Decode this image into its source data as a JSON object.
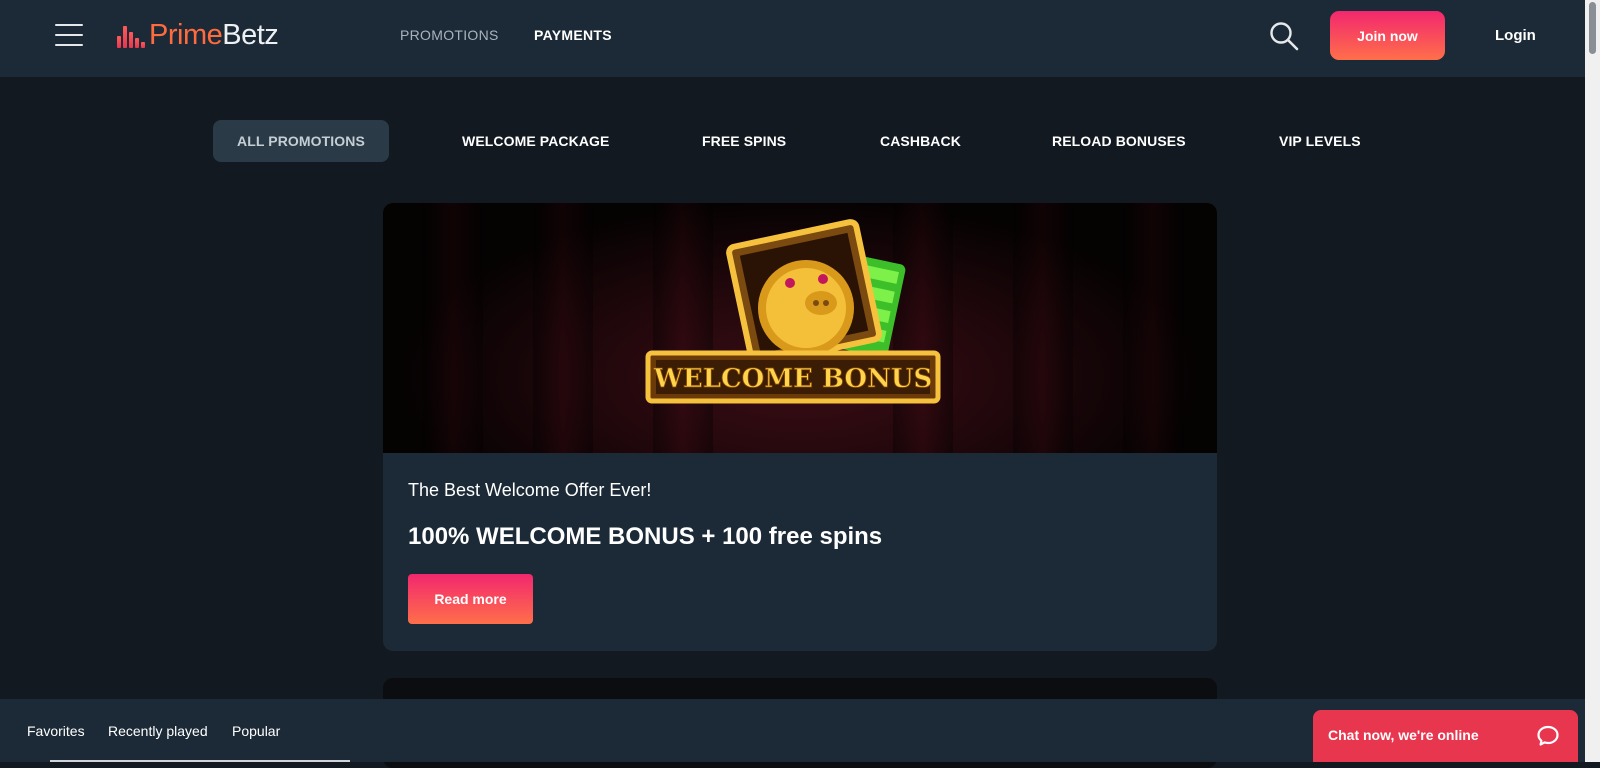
{
  "header": {
    "logo_prime": "Prime",
    "logo_betz": "Betz",
    "nav": [
      {
        "label": "PROMOTIONS"
      },
      {
        "label": "PAYMENTS"
      }
    ],
    "join_label": "Join now",
    "login_label": "Login"
  },
  "tabs": [
    {
      "label": "ALL PROMOTIONS",
      "active": true
    },
    {
      "label": "WELCOME PACKAGE"
    },
    {
      "label": "FREE SPINS"
    },
    {
      "label": "CASHBACK"
    },
    {
      "label": "RELOAD BONUSES"
    },
    {
      "label": "VIP LEVELS"
    }
  ],
  "promo": {
    "banner_text": "WELCOME BONUS",
    "subtitle": "The Best Welcome Offer Ever!",
    "title": "100% WELCOME BONUS + 100 free spins",
    "button_label": "Read more"
  },
  "bottom_bar": {
    "links": [
      {
        "label": "Favorites"
      },
      {
        "label": "Recently played"
      },
      {
        "label": "Popular"
      }
    ]
  },
  "chat": {
    "label": "Chat now, we're online",
    "icon": "chat-bubble-icon"
  },
  "colors": {
    "header_bg": "#1b2a36",
    "page_bg": "#121920",
    "accent_gradient_start": "#f2276e",
    "accent_gradient_end": "#ff6f4a",
    "chat_bg": "#e8364f",
    "logo_orange": "#ff6b3d"
  }
}
